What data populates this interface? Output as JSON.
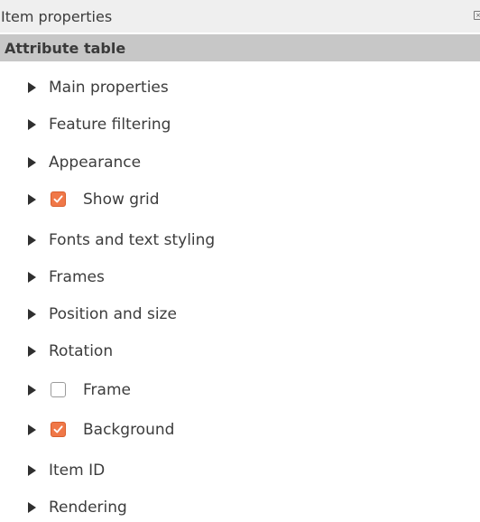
{
  "panel": {
    "title": "Item properties",
    "close_icon": "close-icon",
    "section_title": "Attribute table"
  },
  "groups": [
    {
      "label": "Main properties",
      "checkbox": null
    },
    {
      "label": "Feature filtering",
      "checkbox": null
    },
    {
      "label": "Appearance",
      "checkbox": null
    },
    {
      "label": "Show grid",
      "checkbox": true
    },
    {
      "label": "Fonts and text styling",
      "checkbox": null
    },
    {
      "label": "Frames",
      "checkbox": null
    },
    {
      "label": "Position and size",
      "checkbox": null
    },
    {
      "label": "Rotation",
      "checkbox": null
    },
    {
      "label": "Frame",
      "checkbox": false
    },
    {
      "label": "Background",
      "checkbox": true
    },
    {
      "label": "Item ID",
      "checkbox": null
    },
    {
      "label": "Rendering",
      "checkbox": null
    }
  ],
  "colors": {
    "checked": "#f07848",
    "header_bg": "#c7c7c7",
    "titlebar_bg": "#efefef"
  }
}
